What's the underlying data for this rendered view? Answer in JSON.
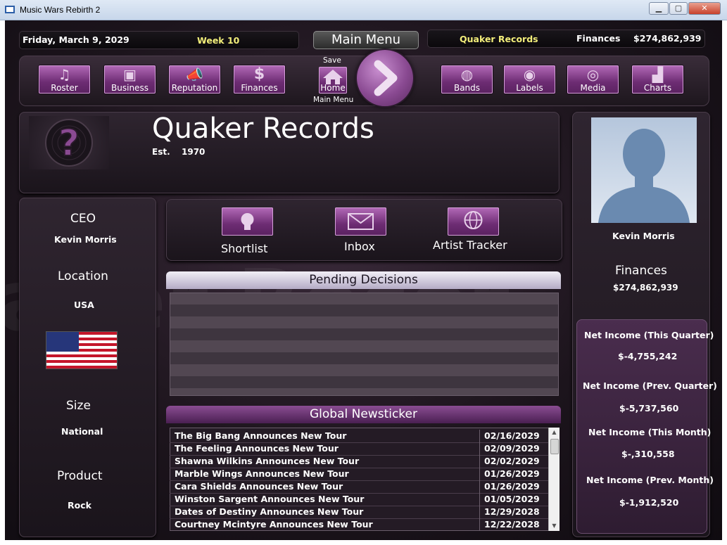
{
  "window": {
    "title": "Music Wars Rebirth 2",
    "minimize": "▁",
    "maximize": "▢",
    "close": "✕"
  },
  "topbar": {
    "date": "Friday, March 9, 2029",
    "week": "Week 10",
    "main_menu": "Main Menu",
    "label_name": "Quaker Records",
    "finances_label": "Finances",
    "finances_value": "$274,862,939"
  },
  "nav": {
    "left": [
      {
        "label": "Roster",
        "icon": "♫"
      },
      {
        "label": "Business",
        "icon": "▣"
      },
      {
        "label": "Reputation",
        "icon": "📣"
      },
      {
        "label": "Finances",
        "icon": "$"
      }
    ],
    "save": "Save",
    "home": "Home",
    "main_menu_caption": "Main Menu",
    "right": [
      {
        "label": "Bands",
        "icon": "◍"
      },
      {
        "label": "Labels",
        "icon": "◉"
      },
      {
        "label": "Media",
        "icon": "◎"
      },
      {
        "label": "Charts",
        "icon": "▟"
      }
    ]
  },
  "label": {
    "name": "Quaker Records",
    "est_label": "Est.",
    "est_year": "1970",
    "logo_glyph": "?"
  },
  "ceo_panel": {
    "ceo_title": "CEO",
    "ceo_name": "Kevin Morris",
    "location_title": "Location",
    "location": "USA",
    "size_title": "Size",
    "size": "National",
    "product_title": "Product",
    "product": "Rock"
  },
  "actions": [
    {
      "label": "Shortlist",
      "icon": "lightbulb-icon"
    },
    {
      "label": "Inbox",
      "icon": "envelope-icon"
    },
    {
      "label": "Artist Tracker",
      "icon": "globe-icon"
    }
  ],
  "pending": {
    "title": "Pending Decisions"
  },
  "news": {
    "title": "Global Newsticker",
    "rows": [
      {
        "headline": "The Big Bang Announces New Tour",
        "date": "02/16/2029"
      },
      {
        "headline": "The Feeling Announces New Tour",
        "date": "02/09/2029"
      },
      {
        "headline": "Shawna Wilkins Announces New Tour",
        "date": "02/02/2029"
      },
      {
        "headline": "Marble Wings Announces New Tour",
        "date": "01/26/2029"
      },
      {
        "headline": "Cara Shields Announces New Tour",
        "date": "01/26/2029"
      },
      {
        "headline": "Winston Sargent Announces New Tour",
        "date": "01/05/2029"
      },
      {
        "headline": "Dates of Destiny Announces New Tour",
        "date": "12/29/2028"
      },
      {
        "headline": "Courtney Mcintyre Announces New Tour",
        "date": "12/22/2028"
      }
    ]
  },
  "profile": {
    "name": "Kevin Morris",
    "finances_title": "Finances",
    "finances_value": "$274,862,939"
  },
  "income": [
    {
      "label": "Net Income (This Quarter)",
      "value": "$-4,755,242"
    },
    {
      "label": "Net Income (Prev. Quarter)",
      "value": "$-5,737,560"
    },
    {
      "label": "Net Income (This Month)",
      "value": "$-,310,558"
    },
    {
      "label": "Net Income (Prev. Month)",
      "value": "$-1,912,520"
    }
  ],
  "colors": {
    "accent_purple": "#8a4a92",
    "highlight_yellow": "#f2ee7a"
  }
}
